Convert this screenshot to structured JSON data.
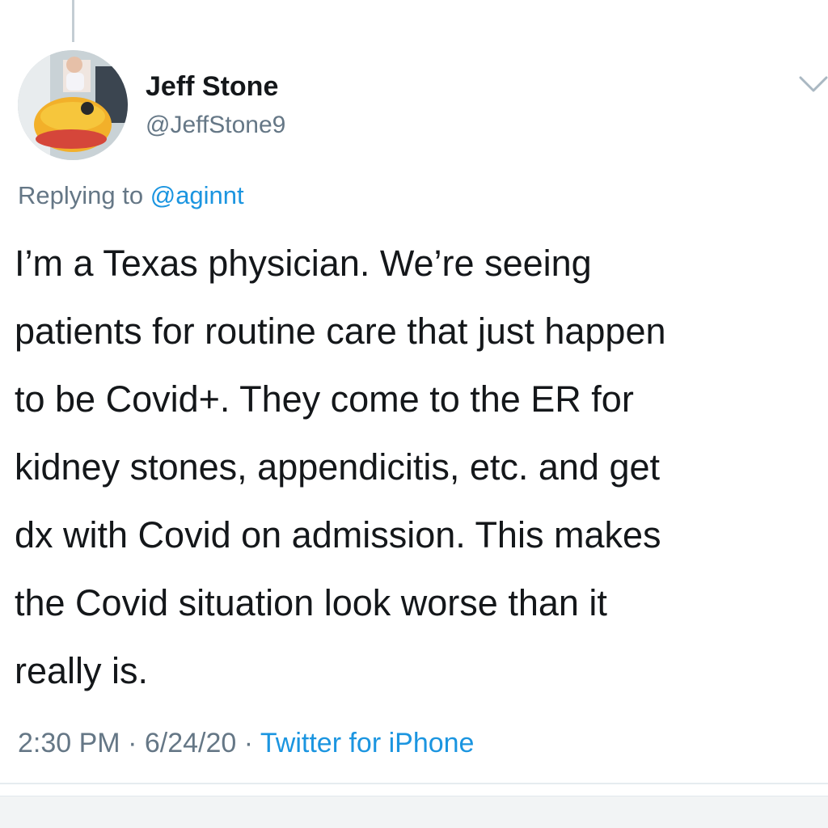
{
  "tweet": {
    "author": {
      "name": "Jeff Stone",
      "handle": "@JeffStone9",
      "avatar_icon": "profile-photo-icon"
    },
    "reply": {
      "prefix": "Replying to ",
      "to": "@aginnt"
    },
    "body_lines": [
      "I’m a Texas physician. We’re seeing",
      "patients for routine care that just happen",
      "to be Covid+. They come to the ER for",
      "kidney stones, appendicitis, etc. and get",
      "dx with Covid on admission. This makes",
      "the Covid situation look worse than it",
      "really is."
    ],
    "meta": {
      "time": "2:30 PM",
      "separator": " · ",
      "date": "6/24/20",
      "source": "Twitter for iPhone"
    },
    "menu_icon": "chevron-down-icon"
  },
  "colors": {
    "text": "#14171a",
    "secondary": "#657786",
    "link": "#1b95e0",
    "divider": "#e6ecf0"
  }
}
